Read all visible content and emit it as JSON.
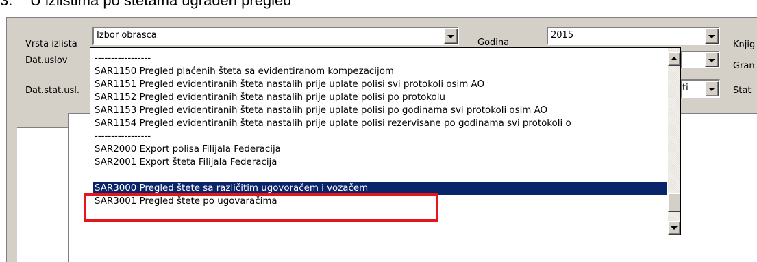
{
  "heading": {
    "number": "3.",
    "text": "U izlistima po štetama ugrađen pregled"
  },
  "form": {
    "vrsta_label": "Vrsta izlista",
    "vrsta_value": "Izbor obrasca",
    "godina_label": "Godina",
    "godina_value": "2015",
    "knjig_label": "Knjig",
    "datuslov_label": "Dat.uslov",
    "gran_label": "Gran",
    "datstat_label": "Dat.stat.usl.",
    "stat_label": "Stat",
    "partial_combo_value": "ti"
  },
  "dropdown": {
    "items": [
      {
        "text": "-----------------",
        "selected": false
      },
      {
        "text": "SAR1150 Pregled plaćenih šteta sa evidentiranom kompezacijom",
        "selected": false
      },
      {
        "text": "SAR1151 Pregled evidentiranih šteta nastalih prije uplate polisi svi protokoli osim AO",
        "selected": false
      },
      {
        "text": "SAR1152 Pregled evidentiranih šteta nastalih prije uplate polisi po protokolu",
        "selected": false
      },
      {
        "text": "SAR1153 Pregled evidentiranih šteta nastalih prije uplate polisi po godinama svi protokoli osim AO",
        "selected": false
      },
      {
        "text": "SAR1154 Pregled evidentiranih šteta nastalih prije uplate polisi rezervisane po godinama svi protokoli o",
        "selected": false
      },
      {
        "text": "-----------------",
        "selected": false
      },
      {
        "text": "SAR2000 Export polisa Filijala Federacija",
        "selected": false
      },
      {
        "text": "SAR2001 Export šteta Filijala Federacija",
        "selected": false
      },
      {
        "text": "",
        "selected": false
      },
      {
        "text": "SAR3000 Pregled štete sa različitim ugovoračem i vozačem",
        "selected": true
      },
      {
        "text": "SAR3001 Pregled štete po ugovaračima",
        "selected": false
      }
    ]
  },
  "colors": {
    "selection": "#0a246a",
    "highlight_box": "#e8141c",
    "panel": "#d4d0c8"
  }
}
